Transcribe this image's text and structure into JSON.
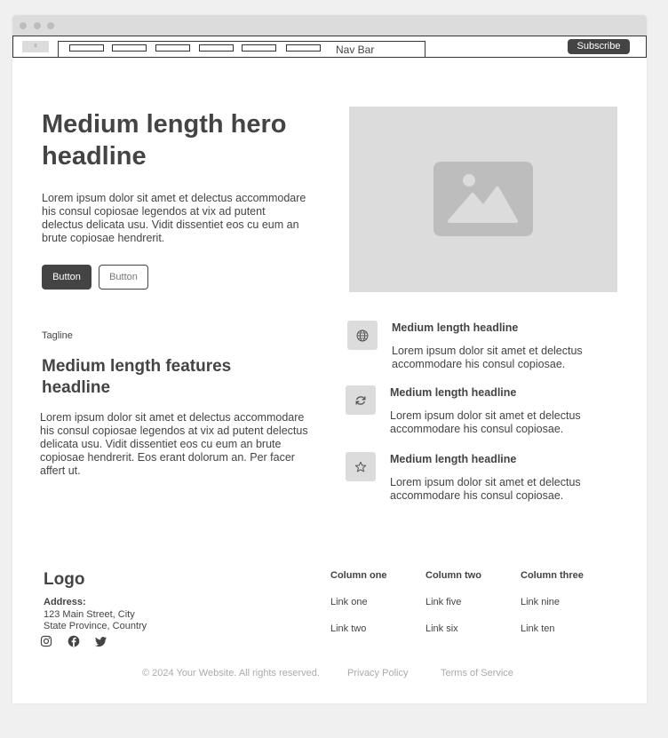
{
  "nav": {
    "logo_text": "≡",
    "label": "Nav Bar",
    "subscribe_label": "Subscribe"
  },
  "hero": {
    "title": "Medium length hero headline",
    "text": "Lorem ipsum dolor sit amet et delectus accommodare his consul copiosae legendos at vix ad putent delectus delicata usu. Vidit dissentiet eos cu eum an brute copiosae hendrerit.",
    "primary_button": "Button",
    "secondary_button": "Button",
    "image_icon": "image-placeholder-icon"
  },
  "features": {
    "tagline": "Tagline",
    "title": "Medium length features headline",
    "text": "Lorem ipsum dolor sit amet et delectus accommodare his consul copiosae legendos at vix ad putent delectus delicata usu. Vidit dissentiet eos cu eum an brute copiosae hendrerit. Eos erant dolorum an. Per facer affert ut.",
    "items": [
      {
        "icon": "globe-icon",
        "title": "Medium length headline",
        "text": "Lorem ipsum dolor sit amet et delectus accommodare his consul copiosae."
      },
      {
        "icon": "refresh-icon",
        "title": "Medium length headline",
        "text": "Lorem ipsum dolor sit amet et delectus accommodare his consul copiosae."
      },
      {
        "icon": "star-icon",
        "title": "Medium length headline",
        "text": "Lorem ipsum dolor sit amet et delectus accommodare his consul copiosae."
      }
    ]
  },
  "footer": {
    "logo": "Logo",
    "address_label": "Address:",
    "address_line1": "123 Main Street, City",
    "address_line2": "State Province, Country",
    "social": [
      "instagram-icon",
      "facebook-icon",
      "twitter-icon"
    ],
    "columns": [
      {
        "title": "Column one",
        "links": [
          "Link one",
          "Link two"
        ]
      },
      {
        "title": "Column two",
        "links": [
          "Link five",
          "Link six"
        ]
      },
      {
        "title": "Column three",
        "links": [
          "Link nine",
          "Link ten"
        ]
      }
    ],
    "copyright": "© 2024 Your Website. All rights reserved.",
    "privacy": "Privacy Policy",
    "terms": "Terms of Service"
  }
}
